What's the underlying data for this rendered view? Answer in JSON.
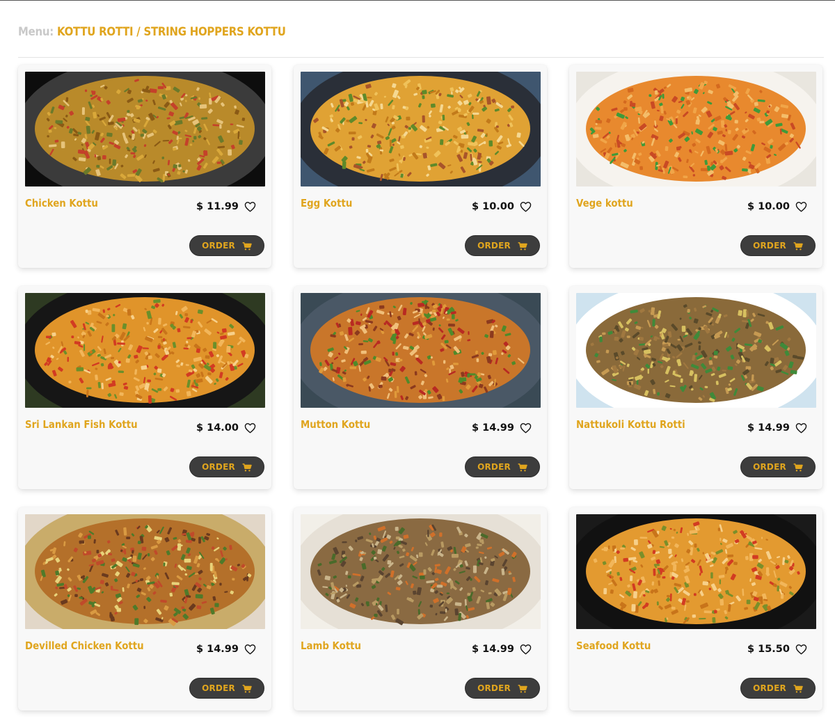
{
  "breadcrumb": {
    "prefix": "Menu:",
    "category": "KOTTU ROTTI",
    "separator": "/",
    "subcategory": "STRING HOPPERS KOTTU"
  },
  "order_label": "ORDER",
  "colors": {
    "accent": "#e0a51e",
    "button_bg": "#3d3d3d",
    "card_bg": "#f8f8f8"
  },
  "items": [
    {
      "name": "Chicken Kottu",
      "price": "$ 11.99"
    },
    {
      "name": "Egg Kottu",
      "price": "$ 10.00"
    },
    {
      "name": "Vege kottu",
      "price": "$ 10.00"
    },
    {
      "name": "Sri Lankan Fish Kottu",
      "price": "$ 14.00"
    },
    {
      "name": "Mutton Kottu",
      "price": "$ 14.99"
    },
    {
      "name": "Nattukoli Kottu Rotti",
      "price": "$ 14.99"
    },
    {
      "name": "Devilled Chicken Kottu",
      "price": "$ 14.99"
    },
    {
      "name": "Lamb Kottu",
      "price": "$ 14.99"
    },
    {
      "name": "Seafood Kottu",
      "price": "$ 15.50"
    }
  ]
}
